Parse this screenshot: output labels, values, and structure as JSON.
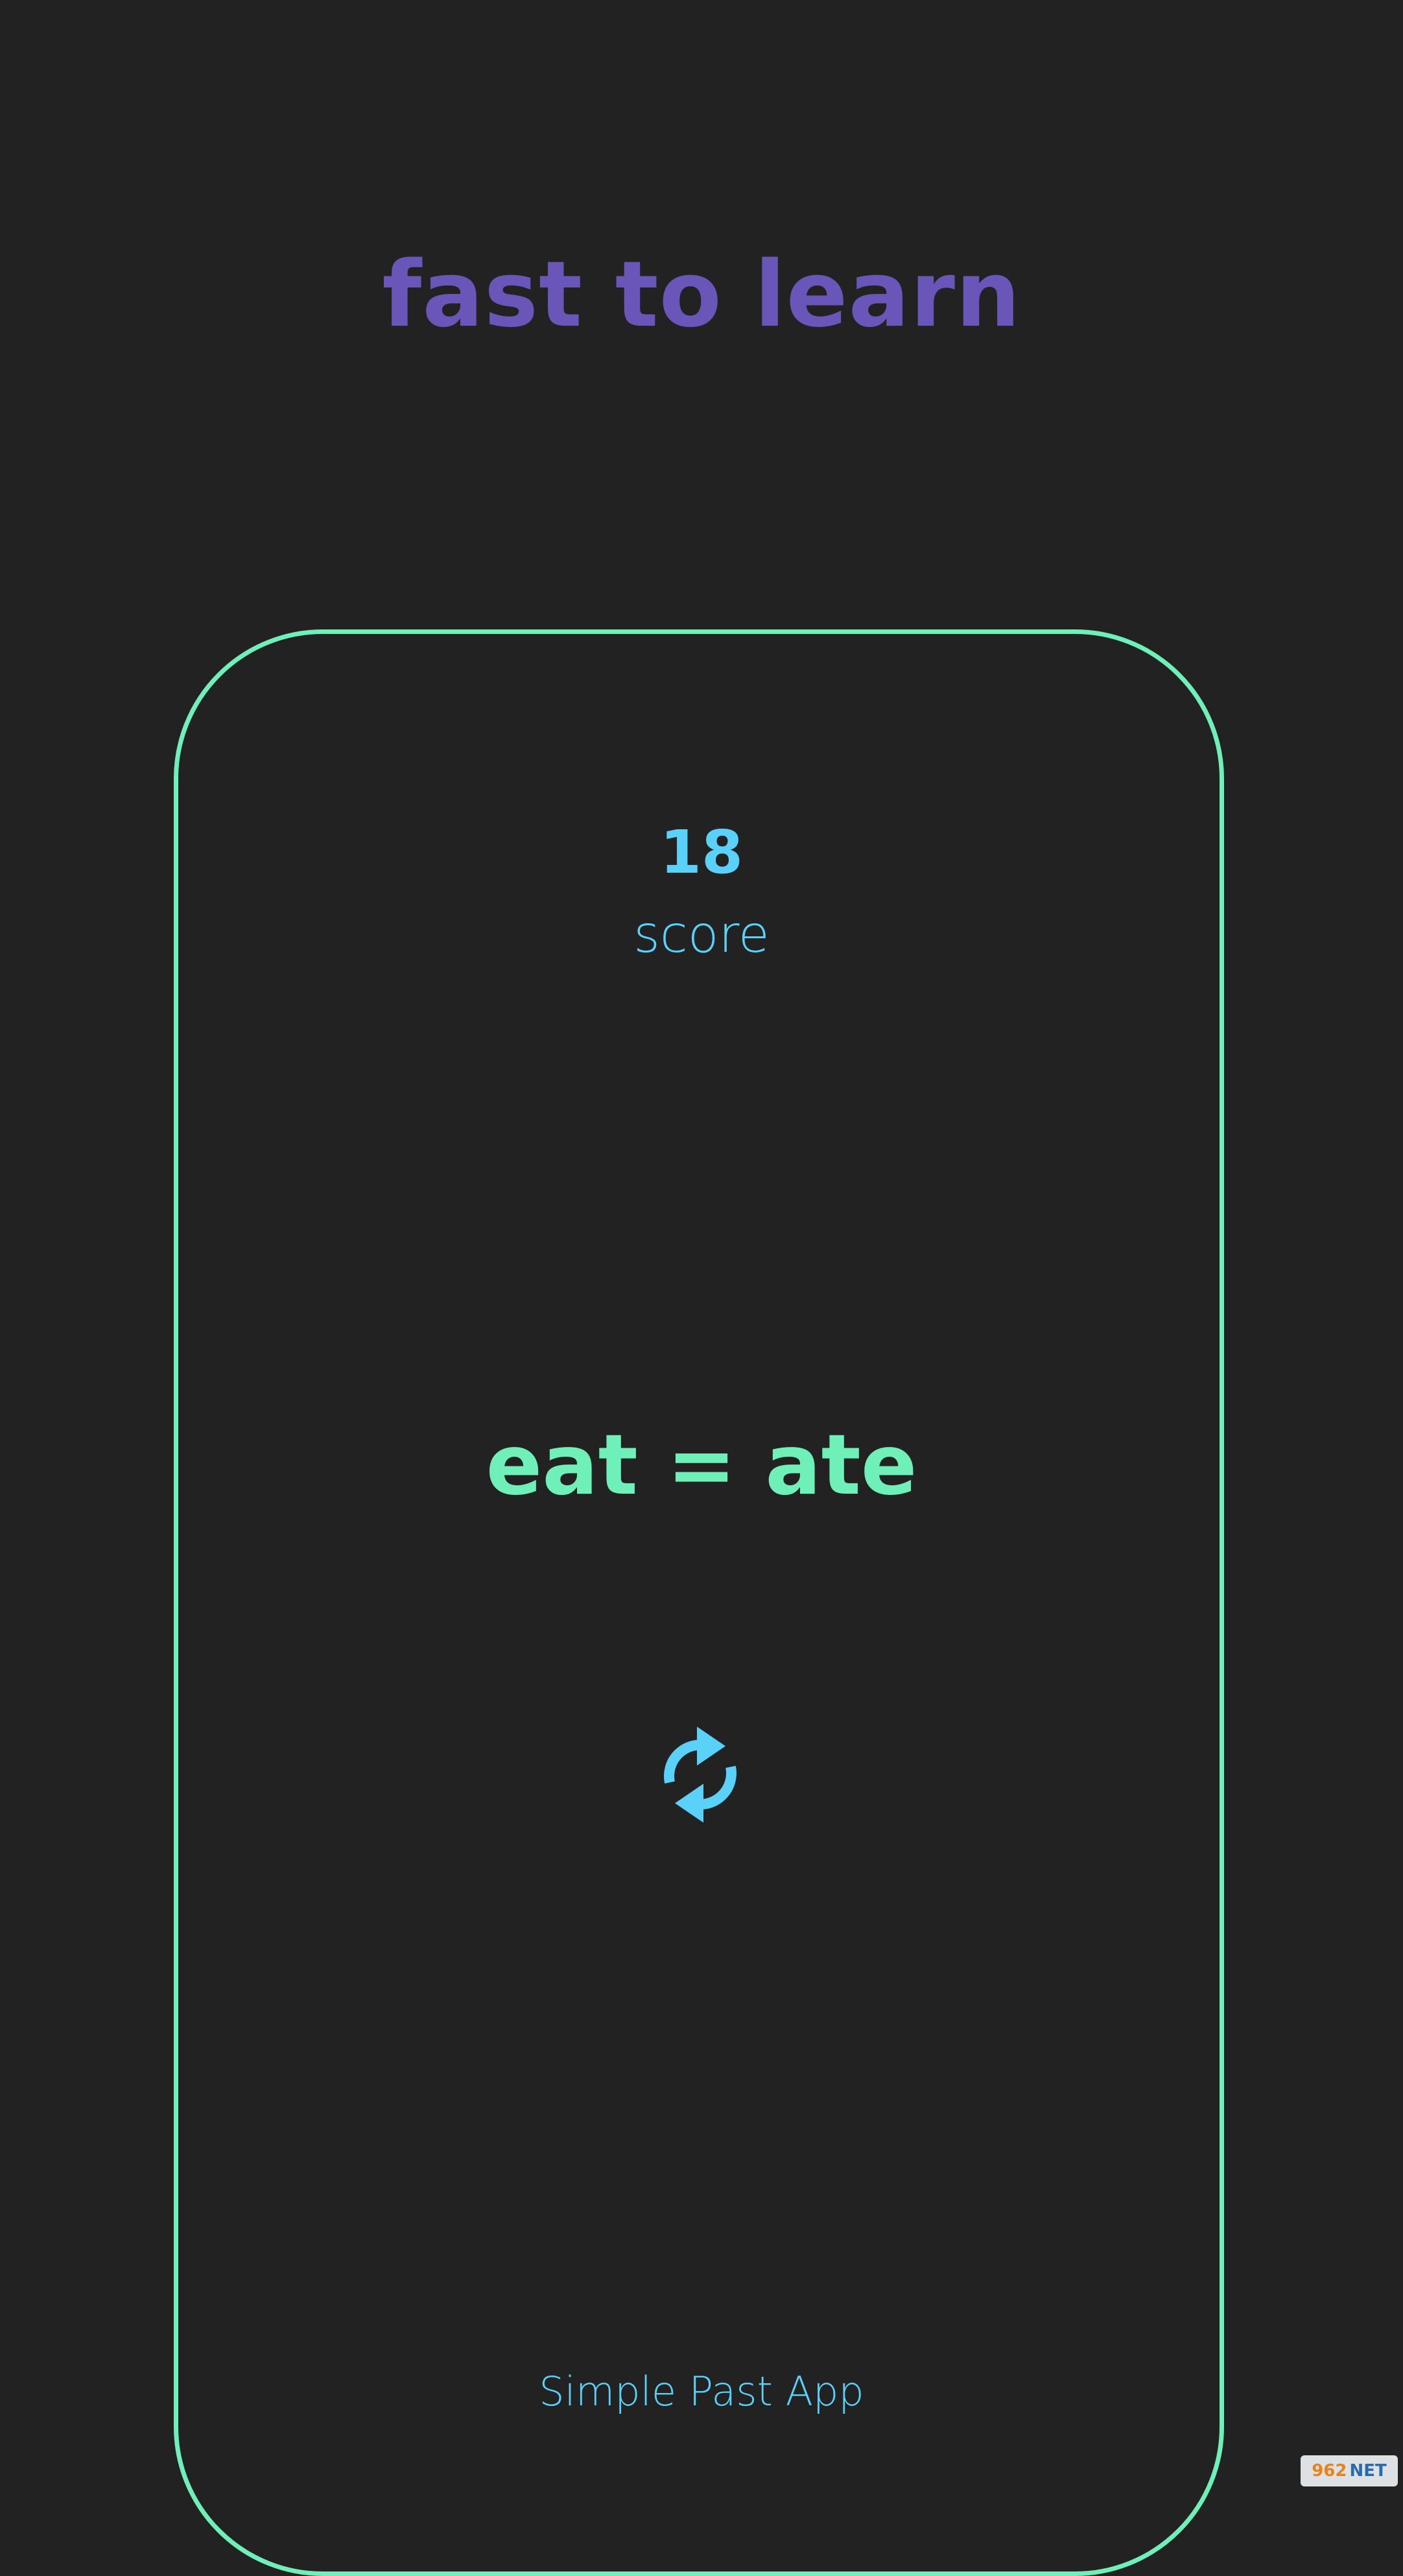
{
  "header": {
    "title": "fast to learn"
  },
  "score": {
    "value": "18",
    "label": "score"
  },
  "card": {
    "verb_pair": "eat = ate",
    "refresh_icon": "refresh-icon"
  },
  "footer": {
    "app_name": "Simple Past App"
  },
  "watermark": {
    "number": "962",
    "suffix": "NET"
  },
  "colors": {
    "background": "#222222",
    "title": "#6a55b9",
    "card_border": "#6ff0b8",
    "accent_blue": "#5ad1f8",
    "accent_green": "#6ff0b8"
  }
}
